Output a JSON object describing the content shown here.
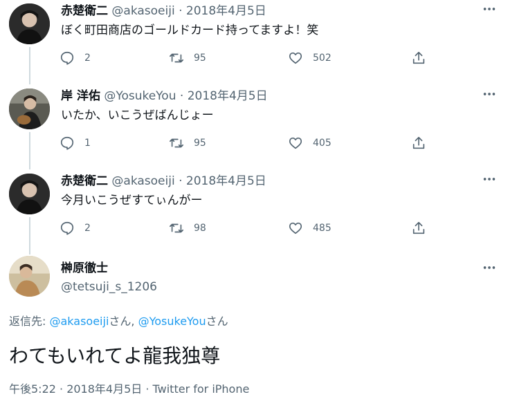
{
  "thread": [
    {
      "name": "赤楚衛二",
      "handle": "@akasoeiji",
      "separator": "·",
      "date": "2018年4月5日",
      "text": "ぼく町田商店のゴールドカード持ってますよ！笑",
      "replies": "2",
      "retweets": "95",
      "likes": "502"
    },
    {
      "name": "岸 洋佑",
      "handle": "@YosukeYou",
      "separator": "·",
      "date": "2018年4月5日",
      "text": "いたか、いこうぜばんじょー",
      "replies": "1",
      "retweets": "95",
      "likes": "405"
    },
    {
      "name": "赤楚衛二",
      "handle": "@akasoeiji",
      "separator": "·",
      "date": "2018年4月5日",
      "text": "今月いこうぜすてぃんがー",
      "replies": "2",
      "retweets": "98",
      "likes": "485"
    }
  ],
  "main_tweet": {
    "name": "榊原徹士",
    "handle": "@tetsuji_s_1206",
    "replying_prefix": "返信先: ",
    "mention1": "@akasoeiji",
    "san1": "さん, ",
    "mention2": "@YosukeYou",
    "san2": "さん",
    "text": "わてもいれてよ龍我独尊",
    "meta": "午後5:22 · 2018年4月5日 · Twitter for iPhone"
  },
  "icons": {
    "reply": "speech-bubble-icon",
    "retweet": "retweet-icon",
    "like": "heart-icon",
    "share": "share-upload-icon",
    "more": "more-dots-icon"
  },
  "colors": {
    "text": "#0f1419",
    "secondary": "#536471",
    "link": "#1d9bf0",
    "thread_line": "#cfd9de"
  }
}
